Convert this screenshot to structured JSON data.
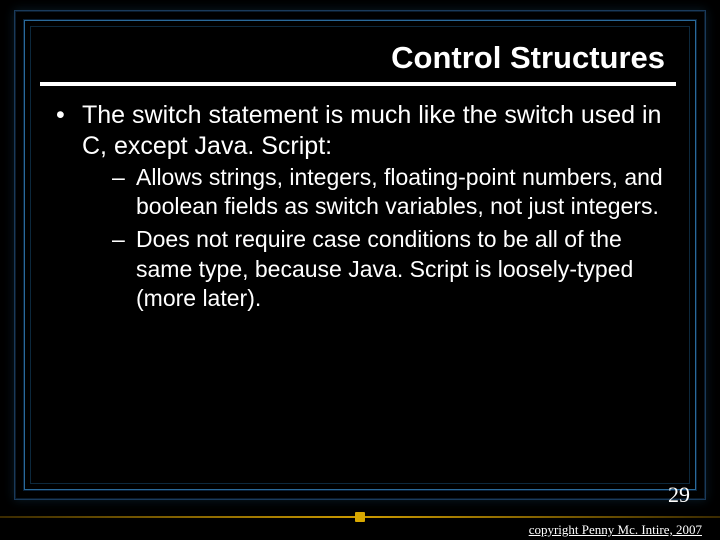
{
  "slide": {
    "title": "Control Structures",
    "bullet1_pre": "The ",
    "bullet1_sw1": "switch",
    "bullet1_mid": " statement is much like the ",
    "bullet1_sw2": "switch",
    "bullet1_post": " used in C, except Java. Script:",
    "sub1": "Allows strings, integers, floating-point numbers, and boolean fields as switch variables, not just integers.",
    "sub2": "Does not require case conditions to be all of the same type, because Java. Script is loosely-typed (more later).",
    "number": "29",
    "copyright": "copyright Penny Mc. Intire, 2007"
  }
}
